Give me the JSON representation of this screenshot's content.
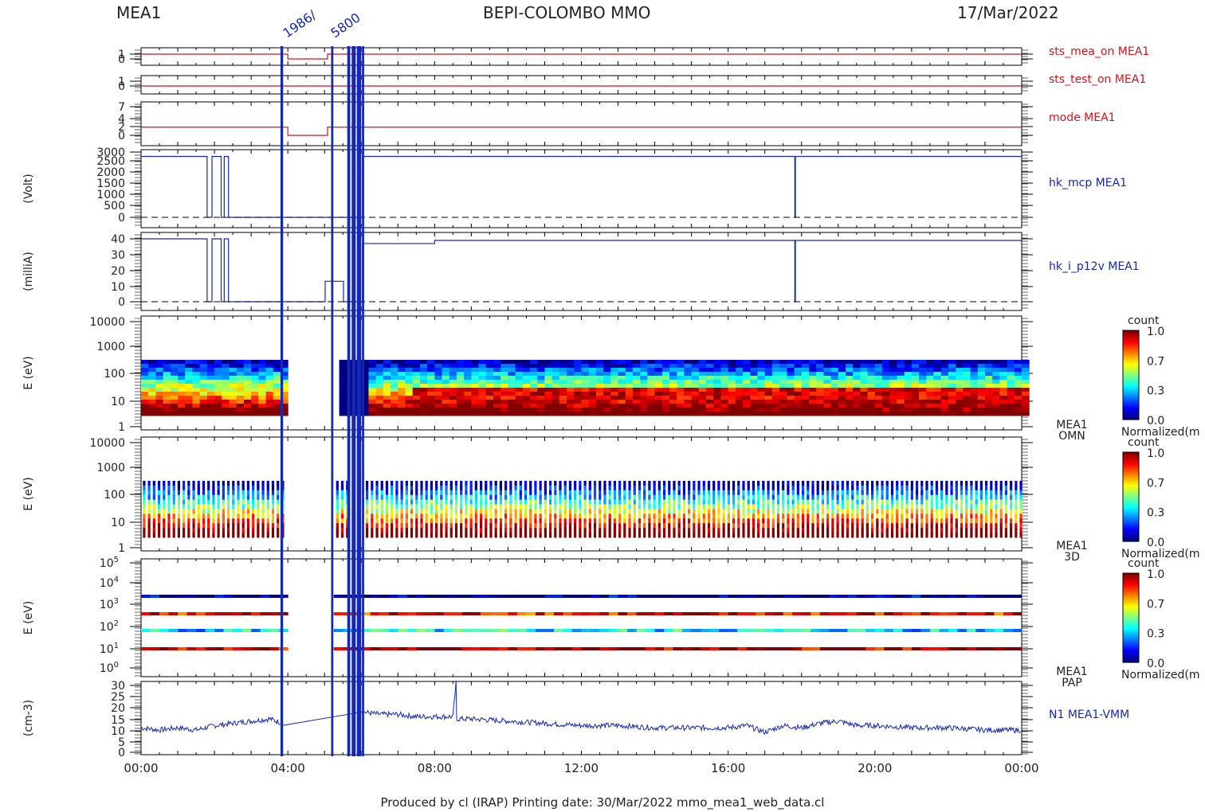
{
  "header": {
    "instrument": "MEA1",
    "mission": "BEPI-COLOMBO MMO",
    "date": "17/Mar/2022"
  },
  "footer": "Produced by cl (IRAP)    Printing date: 30/Mar/2022    mmo_mea1_web_data.cl",
  "colors": {
    "red": "#d4141c",
    "blue": "#1428b4",
    "axis": "#000000"
  },
  "chart_data": [
    {
      "type": "line",
      "label": "sts_mea_on MEA1",
      "y_ticks": [
        "1",
        "0"
      ],
      "series": [
        {
          "x": [
            "00:00",
            "03:55",
            "04:00",
            "05:05",
            "24:00"
          ],
          "y": [
            1,
            1,
            0,
            1,
            1
          ]
        }
      ]
    },
    {
      "type": "line",
      "label": "sts_test_on MEA1",
      "y_ticks": [
        "1",
        "0"
      ],
      "series": [
        {
          "x": [
            "00:00",
            "24:00"
          ],
          "y": [
            0,
            0
          ]
        }
      ]
    },
    {
      "type": "line",
      "label": "mode MEA1",
      "y_ticks": [
        "7",
        "4",
        "2",
        "0"
      ],
      "series": [
        {
          "x": [
            "00:00",
            "03:55",
            "04:00",
            "05:05",
            "24:00"
          ],
          "y": [
            2,
            2,
            0,
            2,
            2
          ]
        }
      ]
    },
    {
      "type": "line",
      "label": "hk_mcp MEA1",
      "ylabel": "(Volt)",
      "y_ticks": [
        "3000",
        "2500",
        "2000",
        "1500",
        "1000",
        "500",
        "0"
      ],
      "ylim": [
        0,
        3000
      ],
      "series": [
        {
          "x": [
            "00:00",
            "01:47",
            "01:48",
            "01:55",
            "01:56",
            "02:10",
            "02:11",
            "02:15",
            "02:16",
            "02:22",
            "02:23",
            "03:52",
            "03:53",
            "06:00",
            "06:02",
            "17:48",
            "17:49",
            "17:50",
            "24:00"
          ],
          "y": [
            2800,
            2800,
            0,
            0,
            2800,
            2800,
            0,
            0,
            2800,
            2800,
            0,
            0,
            0,
            0,
            2800,
            2800,
            0,
            2800,
            2800
          ]
        }
      ]
    },
    {
      "type": "line",
      "label": "hk_i_p12v MEA1",
      "ylabel": "(milliA)",
      "y_ticks": [
        "40",
        "30",
        "20",
        "10",
        "0"
      ],
      "ylim": [
        0,
        42
      ],
      "series": [
        {
          "x": [
            "00:00",
            "01:47",
            "01:48",
            "01:55",
            "01:56",
            "02:10",
            "02:11",
            "02:15",
            "02:16",
            "02:22",
            "02:23",
            "03:52",
            "03:53",
            "05:00",
            "05:01",
            "05:30",
            "05:31",
            "06:00",
            "06:02",
            "08:00",
            "17:48",
            "17:49",
            "17:50",
            "24:00"
          ],
          "y": [
            40,
            40,
            0,
            0,
            40,
            40,
            0,
            0,
            40,
            40,
            0,
            0,
            0,
            0,
            13,
            13,
            0,
            0,
            37,
            39,
            39,
            0,
            39,
            39
          ]
        }
      ]
    },
    {
      "type": "heatmap",
      "label": "MEA1 OMN",
      "ylabel": "E (eV)",
      "y_ticks": [
        "10000",
        "1000",
        "100",
        "10",
        "1"
      ],
      "colorbar": {
        "title": "count",
        "ticks": [
          "1.0",
          "0.7",
          "0.3",
          "0.0"
        ],
        "caption": "Normalized(m"
      }
    },
    {
      "type": "heatmap",
      "label": "MEA1 3D",
      "ylabel": "E (eV)",
      "y_ticks": [
        "10000",
        "1000",
        "100",
        "10",
        "1"
      ],
      "colorbar": {
        "title": "count",
        "ticks": [
          "1.0",
          "0.7",
          "0.3",
          "0.0"
        ],
        "caption": "Normalized(m"
      }
    },
    {
      "type": "heatmap",
      "label": "MEA1 PAP",
      "ylabel": "E (eV)",
      "y_ticks": [
        "10^5",
        "10^4",
        "10^3",
        "10^2",
        "10^1",
        "10^0"
      ],
      "colorbar": {
        "title": "count",
        "ticks": [
          "1.0",
          "0.7",
          "0.3",
          "0.0"
        ],
        "caption": "Normalized(m"
      }
    },
    {
      "type": "line",
      "label": "N1 MEA1-VMM",
      "ylabel": "(cm-3)",
      "y_ticks": [
        "30",
        "25",
        "20",
        "15",
        "10",
        "5",
        "0"
      ],
      "ylim": [
        0,
        32
      ],
      "series": [
        {
          "x": [
            "00:00",
            "00:30",
            "01:00",
            "01:30",
            "02:00",
            "02:30",
            "03:00",
            "03:30",
            "03:52",
            "06:05",
            "06:30",
            "07:00",
            "07:30",
            "08:00",
            "08:30",
            "08:35",
            "08:36",
            "09:00",
            "10:00",
            "11:00",
            "12:00",
            "13:00",
            "14:00",
            "15:00",
            "16:00",
            "16:30",
            "17:00",
            "17:30",
            "18:00",
            "18:30",
            "19:00",
            "19:30",
            "20:00",
            "21:00",
            "22:00",
            "23:00",
            "24:00"
          ],
          "y": [
            11,
            10,
            11,
            10,
            12,
            13,
            14,
            15,
            13,
            18,
            17,
            17,
            16,
            16,
            16,
            31,
            15,
            15,
            14,
            13,
            12,
            12,
            11,
            11,
            11,
            12,
            9,
            12,
            11,
            13,
            14,
            12,
            12,
            11,
            11,
            10,
            10
          ]
        }
      ]
    }
  ],
  "x_ticks": [
    "00:00",
    "04:00",
    "08:00",
    "12:00",
    "16:00",
    "20:00",
    "00:00"
  ],
  "overlay_labels": [
    "1986/",
    "5800"
  ]
}
